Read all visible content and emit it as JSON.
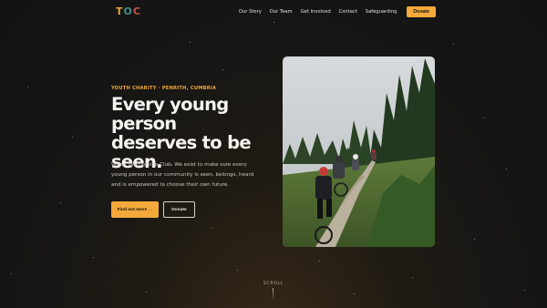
{
  "brand": {
    "letters": [
      "T",
      "O",
      "C"
    ],
    "letter_colors": [
      "#e6a13a",
      "#3f8f8a",
      "#c4554a"
    ]
  },
  "nav": {
    "links": [
      "Our Story",
      "Our Team",
      "Get Involved",
      "Contact",
      "Safeguarding"
    ],
    "donate_label": "Donate"
  },
  "hero": {
    "eyebrow": "YOUTH CHARITY · PENRITH, CUMBRIA",
    "headline_lines": [
      "Every young person",
      "deserves to be",
      "seen."
    ],
    "lede": "We're The Outside Club. We exist to make sure every young person in our community is seen, belongs, heard and is empowered to choose their own future.",
    "primary_button": "Find out more →",
    "secondary_button": "Donate"
  },
  "photo": {
    "icon": "cyclists-forest-photo"
  },
  "scroll_label": "SCROLL",
  "colors": {
    "accent": "#f4a93a",
    "background": "#151515",
    "text": "#f6f4ef"
  }
}
